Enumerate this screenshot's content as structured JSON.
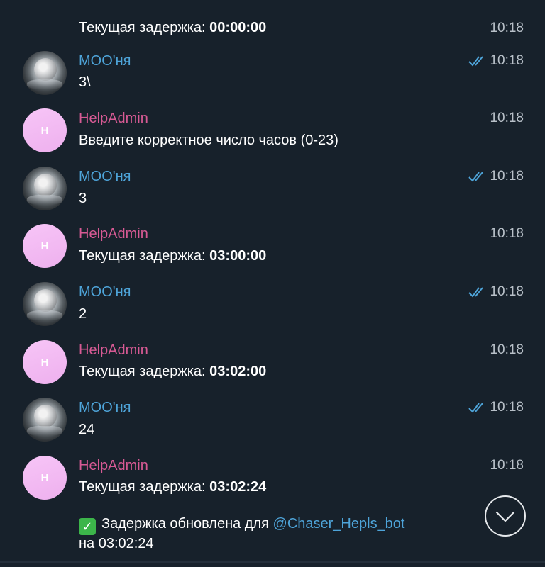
{
  "first_message": {
    "prefix": "Текущая задержка: ",
    "value": "00:00:00",
    "time": "10:18"
  },
  "messages": [
    {
      "sender": "МОО'ня",
      "text": "3\\",
      "time": "10:18"
    },
    {
      "sender": "HelpAdmin",
      "avatar_letter": "H",
      "text": "Введите корректное число часов (0-23)",
      "time": "10:18"
    },
    {
      "sender": "МОО'ня",
      "text": "3",
      "time": "10:18"
    },
    {
      "sender": "HelpAdmin",
      "avatar_letter": "H",
      "prefix": "Текущая задержка: ",
      "value": "03:00:00",
      "time": "10:18"
    },
    {
      "sender": "МОО'ня",
      "text": "2",
      "time": "10:18"
    },
    {
      "sender": "HelpAdmin",
      "avatar_letter": "H",
      "prefix": "Текущая задержка: ",
      "value": "03:02:00",
      "time": "10:18"
    },
    {
      "sender": "МОО'ня",
      "text": "24",
      "time": "10:18"
    },
    {
      "sender": "HelpAdmin",
      "avatar_letter": "H",
      "prefix": "Текущая задержка: ",
      "value": "03:02:24",
      "time": "10:18"
    }
  ],
  "last_message": {
    "emoji": "✓",
    "line1_prefix": "Задержка обновлена для ",
    "mention": "@Chaser_Hepls_bot",
    "line2": "на 03:02:24"
  },
  "colors": {
    "background": "#17212b",
    "sender_user": "#4ea4d9",
    "sender_bot": "#d75a94",
    "timestamp": "#b8c0c8",
    "read_checks": "#4ea4d9"
  },
  "icons": {
    "read_receipt": "double-check-icon",
    "scroll_down": "chevron-down-icon"
  }
}
